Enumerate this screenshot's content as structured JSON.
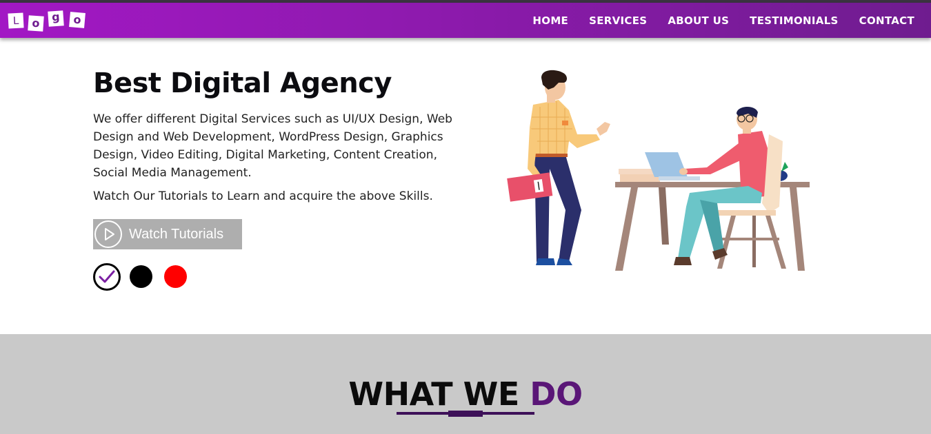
{
  "nav": {
    "logo_letters": [
      "L",
      "o",
      "g",
      "o"
    ],
    "links": [
      {
        "label": "HOME"
      },
      {
        "label": "SERVICES"
      },
      {
        "label": "ABOUT US"
      },
      {
        "label": "TESTIMONIALS"
      },
      {
        "label": "CONTACT"
      }
    ]
  },
  "hero": {
    "title": "Best Digital Agency",
    "description": "We offer different Digital Services such as UI/UX Design, Web Design and Web Development, WordPress Design, Graphics Design, Video Editing, Digital Marketing, Content Creation, Social Media Management.",
    "subtext": "Watch Our Tutorials to Learn and acquire the above Skills.",
    "button_label": "Watch Tutorials",
    "theme_swatches": [
      {
        "color": "#7b1fa2",
        "selected": true
      },
      {
        "color": "#000000",
        "selected": false
      },
      {
        "color": "#ff0000",
        "selected": false
      }
    ]
  },
  "section": {
    "title_main": "WHAT WE ",
    "title_accent": "DO"
  },
  "colors": {
    "navbar_gradient_start": "#a218c4",
    "navbar_gradient_end": "#6f1c8f",
    "accent_purple": "#5a1677",
    "button_gray": "#aeaeae",
    "section_bg": "#c9c9c9"
  }
}
